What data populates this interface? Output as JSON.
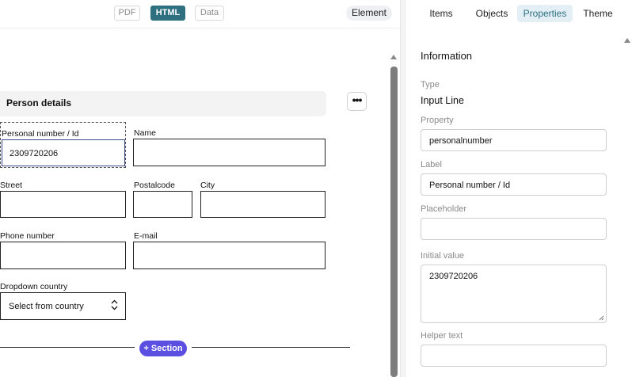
{
  "toolbar": {
    "tabs": [
      {
        "label": "PDF",
        "active": false
      },
      {
        "label": "HTML",
        "active": true
      },
      {
        "label": "Data",
        "active": false
      }
    ],
    "element_label": "Element"
  },
  "form": {
    "section_title": "Person details",
    "more_icon": "more-horizontal-icon",
    "fields": {
      "personal_number": {
        "label": "Personal number / Id",
        "value": "2309720206"
      },
      "name": {
        "label": "Name",
        "value": ""
      },
      "street": {
        "label": "Street",
        "value": ""
      },
      "postalcode": {
        "label": "Postalcode",
        "value": ""
      },
      "city": {
        "label": "City",
        "value": ""
      },
      "phone": {
        "label": "Phone number",
        "value": ""
      },
      "email": {
        "label": "E-mail",
        "value": ""
      },
      "country": {
        "label": "Dropdown country",
        "selected": "Select from country"
      }
    },
    "add_section_label": "+ Section"
  },
  "panel": {
    "tabs": [
      {
        "label": "Items",
        "active": false
      },
      {
        "label": "Objects",
        "active": false
      },
      {
        "label": "Properties",
        "active": true
      },
      {
        "label": "Theme",
        "active": false
      }
    ],
    "info_title": "Information",
    "type_label": "Type",
    "type_value": "Input Line",
    "property_label": "Property",
    "property_value": "personalnumber",
    "label_label": "Label",
    "label_value": "Personal number / Id",
    "placeholder_label": "Placeholder",
    "placeholder_value": "",
    "initial_value_label": "Initial value",
    "initial_value": "2309720206",
    "helper_text_label": "Helper text",
    "helper_text_value": ""
  },
  "colors": {
    "accent": "#2e6f80",
    "section_button": "#5a4fe0",
    "active_tab_bg": "#e3eff4"
  }
}
